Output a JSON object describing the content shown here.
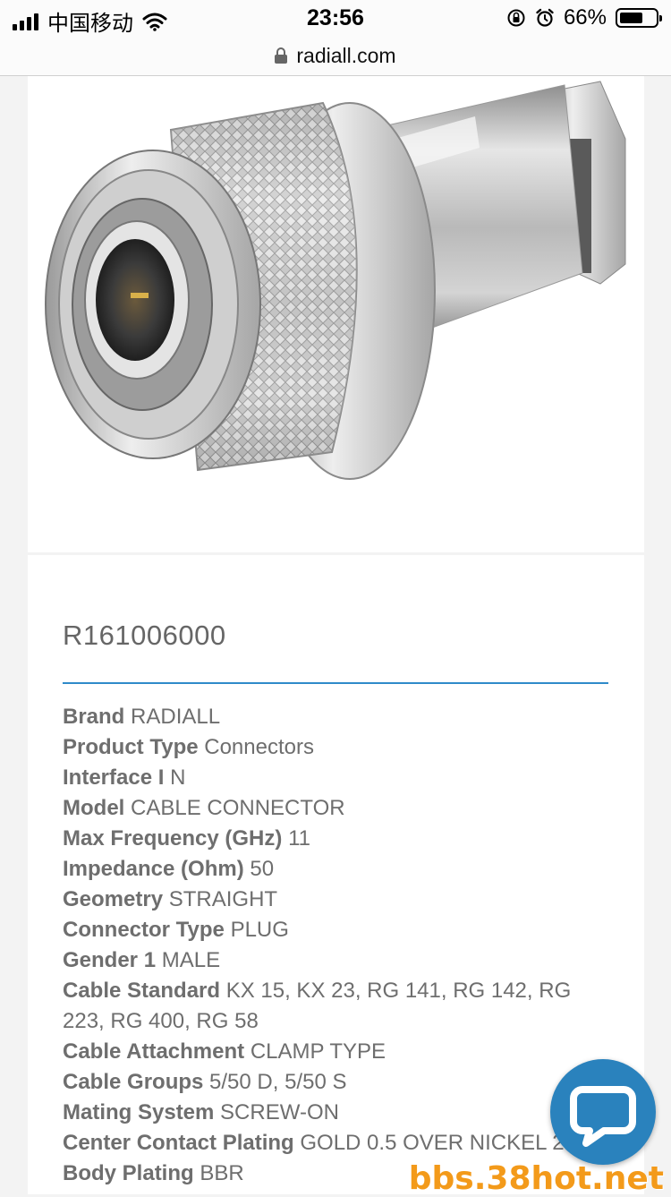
{
  "status_bar": {
    "carrier": "中国移动",
    "time": "23:56",
    "battery_percent": "66%",
    "battery_level": 0.66
  },
  "url_bar": {
    "domain": "radiall.com"
  },
  "product": {
    "part_number": "R161006000",
    "specs": [
      {
        "label": "Brand",
        "value": "RADIALL"
      },
      {
        "label": "Product Type",
        "value": "Connectors"
      },
      {
        "label": "Interface I",
        "value": "N"
      },
      {
        "label": "Model",
        "value": "CABLE CONNECTOR"
      },
      {
        "label": "Max Frequency (GHz)",
        "value": "11"
      },
      {
        "label": "Impedance (Ohm)",
        "value": "50"
      },
      {
        "label": "Geometry",
        "value": "STRAIGHT"
      },
      {
        "label": "Connector Type",
        "value": "PLUG"
      },
      {
        "label": "Gender 1",
        "value": "MALE"
      },
      {
        "label": "Cable Standard",
        "value": "KX 15, KX 23, RG 141, RG 142, RG 223, RG 400, RG 58"
      },
      {
        "label": "Cable Attachment",
        "value": "CLAMP TYPE"
      },
      {
        "label": "Cable Groups",
        "value": "5/50 D, 5/50 S"
      },
      {
        "label": "Mating System",
        "value": "SCREW-ON"
      },
      {
        "label": "Center Contact Plating",
        "value": "GOLD 0.5 OVER NICKEL 2"
      },
      {
        "label": "Body Plating",
        "value": "BBR"
      }
    ]
  },
  "chat": {
    "icon": "chat-bubble-icon",
    "color": "#2a82bd"
  },
  "watermark": "bbs.38hot.net"
}
